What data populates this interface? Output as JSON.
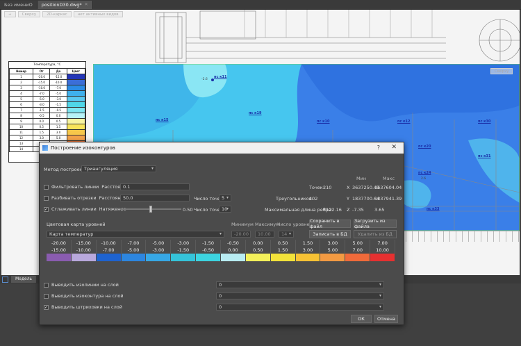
{
  "tabs": [
    {
      "label": "Без имениО",
      "active": false
    },
    {
      "label": "positionD30.dwg*",
      "active": true
    }
  ],
  "canvas_toolbar": [
    "+",
    "Сверху",
    "2D-каркас",
    "нет активных видов"
  ],
  "view_cube_label": "Сверху",
  "legend": {
    "title": "Температура, °С",
    "headers": [
      "Номер",
      "От",
      "До",
      "Цвет"
    ],
    "rows": [
      [
        "1",
        "-20.0",
        "-15.0",
        "#2436b8"
      ],
      [
        "2",
        "-15.0",
        "-10.0",
        "#3b6ed8"
      ],
      [
        "3",
        "-10.0",
        "-7.0",
        "#2b8ce6"
      ],
      [
        "4",
        "-7.0",
        "-5.0",
        "#3fb0ec"
      ],
      [
        "5",
        "-5.0",
        "-3.0",
        "#5ac8f0"
      ],
      [
        "6",
        "-3.0",
        "-1.5",
        "#4fd6e8"
      ],
      [
        "7",
        "-1.5",
        "-0.5",
        "#7fe6f2"
      ],
      [
        "8",
        "-0.5",
        "0.0",
        "#b6f2f7"
      ],
      [
        "9",
        "0.0",
        "0.5",
        "#f7f4a0"
      ],
      [
        "10",
        "0.5",
        "1.5",
        "#f7e45a"
      ],
      [
        "11",
        "1.5",
        "3.0",
        "#f7c74a"
      ],
      [
        "12",
        "3.0",
        "5.0",
        "#f5a34a"
      ],
      [
        "13",
        "5.0",
        "7.0",
        "#f27a3e"
      ],
      [
        "14",
        "7.0",
        "10.0",
        "#e64040"
      ]
    ]
  },
  "points": [
    "пс к11",
    "пс к19",
    "пс к15",
    "пс к10",
    "пс к12",
    "пс к30",
    "пс к20",
    "пс к31",
    "пс к24",
    "пс к33"
  ],
  "contour_values": [
    "-2.6",
    "2.6"
  ],
  "dialog": {
    "title": "Построение изоконтуров",
    "help": "?",
    "close": "✕",
    "method_label": "Метод построения",
    "method_value": "Триангуляция",
    "filter_label": "Фильтровать линии",
    "filter_param": "Расстояние <",
    "filter_value": "0.1",
    "split_label": "Разбивать отрезки",
    "split_param": "Расстояние >",
    "split_value": "50.0",
    "points_label": "Число точек",
    "split_points": "5",
    "smooth_label": "Сглаживать линии",
    "tension_label": "Натяжение",
    "tension_value": "0.50",
    "tension_fraction": 0.5,
    "smooth_points": "10",
    "stats": {
      "min_header": "Мин",
      "max_header": "Макс",
      "points_label": "Точек:",
      "points_value": "210",
      "triangles_label": "Треугольников:",
      "triangles_value": "402",
      "maxedge_label": "Максимальная длина ребра:",
      "maxedge_value": "8122.16",
      "x_label": "X",
      "x_min": "3637250.43",
      "x_max": "3637604.04",
      "y_label": "Y",
      "y_min": "1837700.64",
      "y_max": "1837941.39",
      "z_label": "Z",
      "z_min": "-7.35",
      "z_max": "3.65"
    },
    "colormap_label": "Цветовая карта уровней",
    "colormap_value": "Карта температур",
    "minimum_label": "Минимум",
    "minimum_value": "-20.00",
    "maximum_label": "Максимум",
    "maximum_value": "10.00",
    "levels_label": "Число уровней",
    "levels_value": "14",
    "save_file": "Сохранить в файл",
    "load_file": "Загрузить из файла",
    "save_db": "Записать в БД",
    "delete_db": "Удалить из БД",
    "scale_from": [
      "-20.00",
      "-15.00",
      "-10.00",
      "-7.00",
      "-5.00",
      "-3.00",
      "-1.50",
      "-0.50",
      "0.00",
      "0.50",
      "1.50",
      "3.00",
      "5.00",
      "7.00"
    ],
    "scale_to": [
      "-15.00",
      "-10.00",
      "-7.00",
      "-5.00",
      "-3.00",
      "-1.50",
      "-0.50",
      "0.00",
      "0.50",
      "1.50",
      "3.00",
      "5.00",
      "7.00",
      "10.00"
    ],
    "scale_colors": [
      "#8a5cb0",
      "#b8a8dc",
      "#1e63cf",
      "#2d86e0",
      "#37a8e6",
      "#35c3d9",
      "#3dd4e0",
      "#b8ecf2",
      "#f3f05a",
      "#f2e23a",
      "#f7c234",
      "#f39a42",
      "#f06a3a",
      "#e63030"
    ],
    "out_isolines": "Выводить изолинии на слой",
    "out_isocontours": "Выводить изоконтура на слой",
    "out_hatch": "Выводить штриховки на слой",
    "layer_value": "0",
    "ok": "ОК",
    "cancel": "Отмена"
  },
  "model_tab": "Модель"
}
